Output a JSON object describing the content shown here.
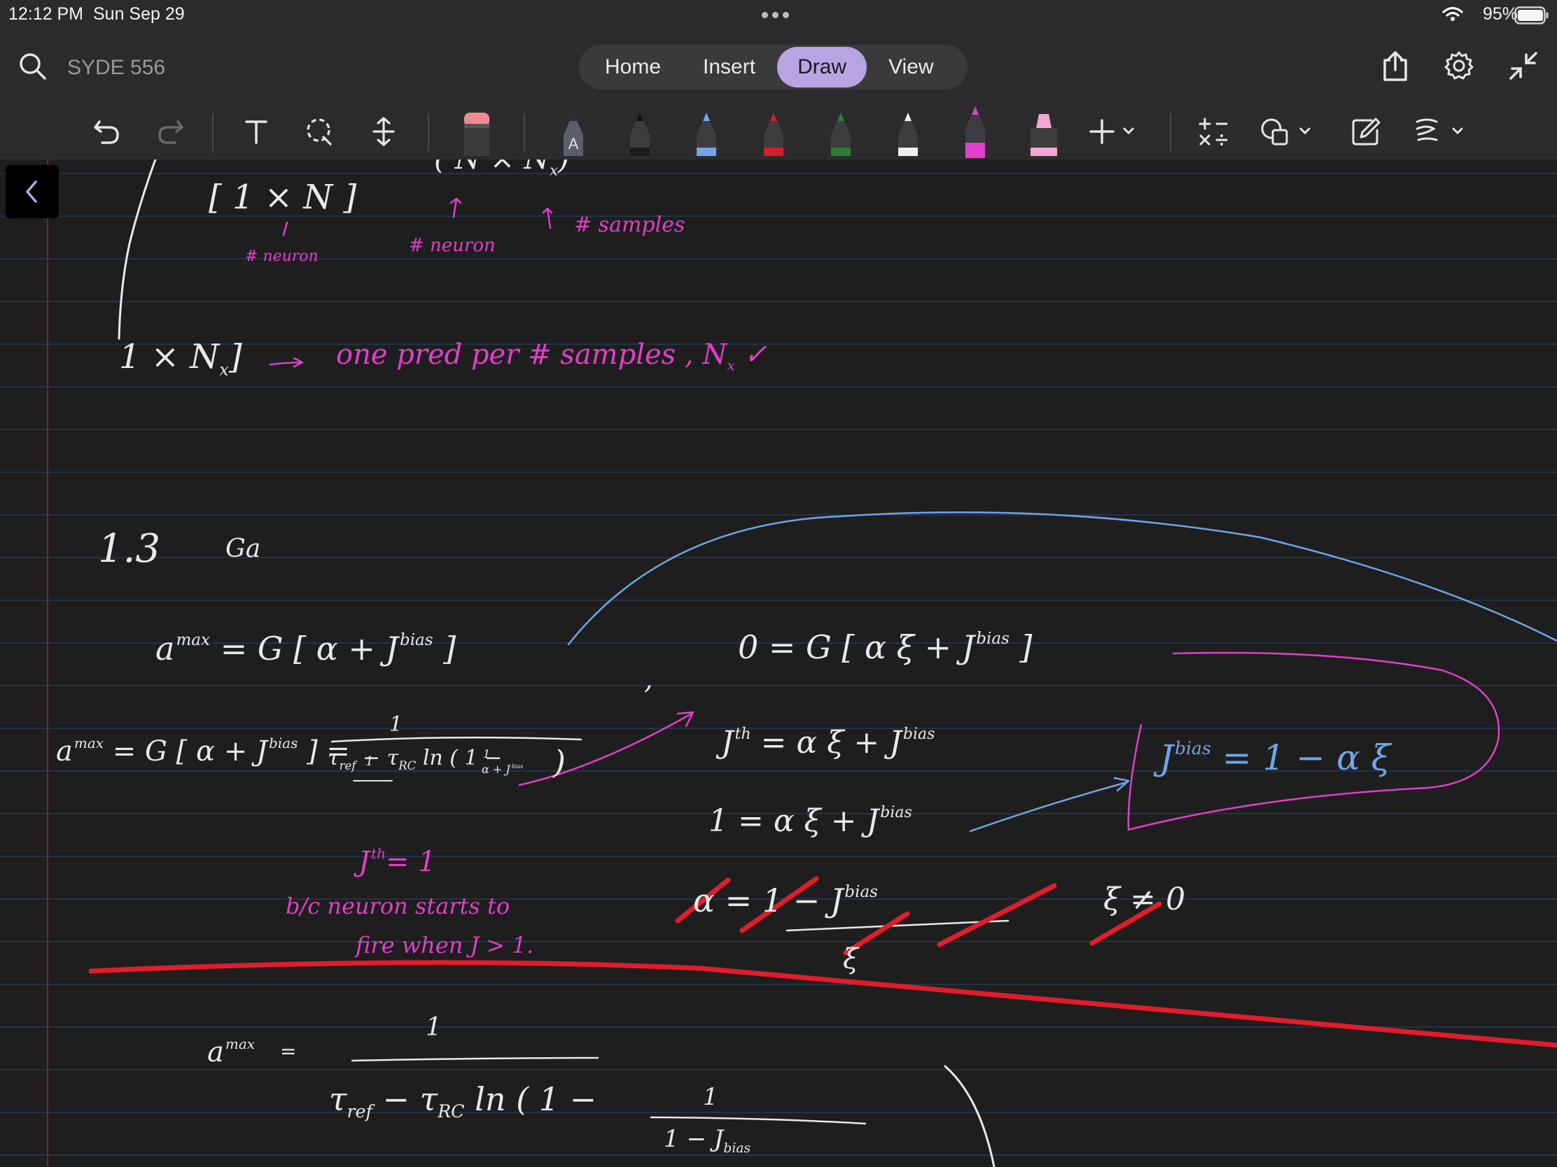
{
  "status_bar": {
    "time": "12:12 PM",
    "date": "Sun Sep 29",
    "battery": "95%"
  },
  "top_bar": {
    "notebook_title": "SYDE 556",
    "tabs": [
      {
        "label": "Home",
        "active": false
      },
      {
        "label": "Insert",
        "active": false
      },
      {
        "label": "Draw",
        "active": true
      },
      {
        "label": "View",
        "active": false
      }
    ],
    "right_icons": [
      "share-icon",
      "settings-gear-icon",
      "collapse-arrows-icon"
    ],
    "accent_color": "#b8a4e3"
  },
  "toolbar": {
    "tools": [
      "undo-icon",
      "redo-icon",
      "text-tool-icon",
      "lasso-select-icon",
      "add-space-icon",
      "eraser-icon"
    ],
    "pens": [
      {
        "name": "pen-auto",
        "color": "#5a5f6b",
        "label": "A"
      },
      {
        "name": "pen-black",
        "color": "#1c1c1c"
      },
      {
        "name": "pen-blue",
        "color": "#6ea6e8"
      },
      {
        "name": "pen-red",
        "color": "#d0202a"
      },
      {
        "name": "pen-green",
        "color": "#2e7d32"
      },
      {
        "name": "pen-white",
        "color": "#f0f0f0"
      },
      {
        "name": "pen-magenta",
        "color": "#e040c8"
      },
      {
        "name": "highlighter-pink",
        "color": "#f4a6d3"
      }
    ],
    "extra": [
      "add-pen-icon",
      "ink-to-math-icon",
      "shapes-icon",
      "ink-to-text-icon",
      "replay-icon"
    ]
  },
  "notes": {
    "l1a": "[ 1 × N ]",
    "l1b": "( N × N",
    "l1b_sub": "x",
    "l1b_end": ")",
    "l1c": "# neuron",
    "l1d": "# neuron",
    "l1e": "# samples",
    "l2a": "1 × N",
    "l2a_sub": "x",
    "l2a_end": "]",
    "l2b": "one pred per # samples , N",
    "l2b_sub": "x",
    "l2b_check": "✓",
    "s13": "1.3",
    "s13b": "Ga",
    "e1_a": "a",
    "e1_sup": "max",
    "e1_rest": "= G [ α +  J",
    "e1_sup2": "bias",
    "e1_end": "]",
    "e1_comma": ",",
    "e2_lhs": "0 =  G [ α ξ + J",
    "e2_sup": "bias",
    "e2_end": "]",
    "e3_a": "a",
    "e3_sup": "max",
    "e3_mid": "= G [ α + J",
    "e3_sup2": "bias",
    "e3_mid2": "] =",
    "e3_num": "1",
    "e3_den": "τ",
    "e3_den1": "ref",
    "e3_den2": "− τ",
    "e3_den3": "RC",
    "e3_den4": "ln ( 1 −",
    "e3_den_frac_num": "1",
    "e3_den_frac_den": "α + J",
    "e3_den_frac_sup": "bias",
    "e3_den_end": ")",
    "e4_lhs": "J",
    "e4_sup": "th",
    "e4_rhs": "=  α ξ + J",
    "e4_sup2": "bias",
    "e5": "1  =  α ξ + J",
    "e5_sup": "bias",
    "jbias": "J",
    "jbias_sup": "bias",
    "jbias_rhs": "=  1  −  α ξ",
    "jth": "J",
    "jth_sup": "th",
    "jth_rhs": "= 1",
    "bc1": "b/c neuron starts to",
    "bc2": "fire when J > 1.",
    "crossed": "α =  1  −  J",
    "crossed_sup": "bias",
    "crossed_den": "ξ",
    "xi_ne0": "ξ ≠ 0",
    "bot_a": "a",
    "bot_sup": "max",
    "bot_eq": "=",
    "bot_num": "1",
    "bot_den": "τ",
    "bot_den1": "ref",
    "bot_den2": "− τ",
    "bot_den3": "RC",
    "bot_den4": "ln ( 1 −",
    "bot_frac_num": "1",
    "bot_frac_den": "1 − J",
    "bot_frac_sub": "bias"
  }
}
